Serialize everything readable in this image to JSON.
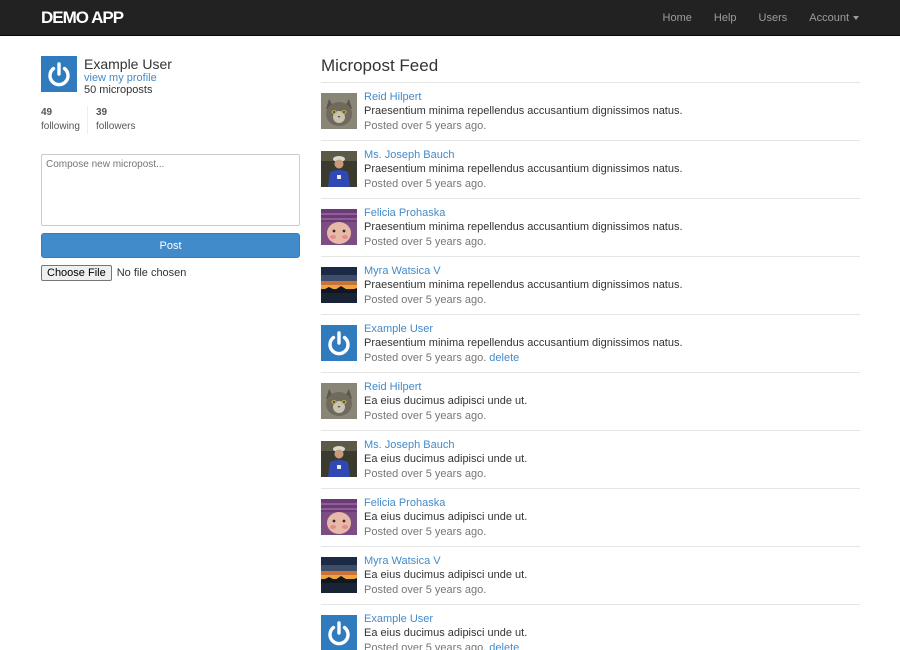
{
  "navbar": {
    "brand": "DEMO APP",
    "links": [
      "Home",
      "Help",
      "Users"
    ],
    "account_label": "Account"
  },
  "sidebar": {
    "user_name": "Example User",
    "profile_link": "view my profile",
    "micropost_count": "50 microposts",
    "stats": [
      {
        "value": "49",
        "label": "following"
      },
      {
        "value": "39",
        "label": "followers"
      }
    ],
    "compose_placeholder": "Compose new micropost...",
    "post_button": "Post",
    "file_button": "Choose File",
    "file_status": "No file chosen"
  },
  "feed": {
    "title": "Micropost Feed",
    "posts": [
      {
        "user": "Reid Hilpert",
        "content": "Praesentium minima repellendus accusantium dignissimos natus.",
        "meta": "Posted over 5 years ago.",
        "avatar": "cat"
      },
      {
        "user": "Ms. Joseph Bauch",
        "content": "Praesentium minima repellendus accusantium dignissimos natus.",
        "meta": "Posted over 5 years ago.",
        "avatar": "person-blue"
      },
      {
        "user": "Felicia Prohaska",
        "content": "Praesentium minima repellendus accusantium dignissimos natus.",
        "meta": "Posted over 5 years ago.",
        "avatar": "baby"
      },
      {
        "user": "Myra Watsica V",
        "content": "Praesentium minima repellendus accusantium dignissimos natus.",
        "meta": "Posted over 5 years ago.",
        "avatar": "sunset"
      },
      {
        "user": "Example User",
        "content": "Praesentium minima repellendus accusantium dignissimos natus.",
        "meta": "Posted over 5 years ago.",
        "avatar": "power",
        "delete": "delete"
      },
      {
        "user": "Reid Hilpert",
        "content": "Ea eius ducimus adipisci unde ut.",
        "meta": "Posted over 5 years ago.",
        "avatar": "cat"
      },
      {
        "user": "Ms. Joseph Bauch",
        "content": "Ea eius ducimus adipisci unde ut.",
        "meta": "Posted over 5 years ago.",
        "avatar": "person-blue"
      },
      {
        "user": "Felicia Prohaska",
        "content": "Ea eius ducimus adipisci unde ut.",
        "meta": "Posted over 5 years ago.",
        "avatar": "baby"
      },
      {
        "user": "Myra Watsica V",
        "content": "Ea eius ducimus adipisci unde ut.",
        "meta": "Posted over 5 years ago.",
        "avatar": "sunset"
      },
      {
        "user": "Example User",
        "content": "Ea eius ducimus adipisci unde ut.",
        "meta": "Posted over 5 years ago.",
        "avatar": "power",
        "delete": "delete"
      }
    ]
  },
  "colors": {
    "navbar_bg": "#222222",
    "link": "#428bca",
    "primary_button": "#428bca",
    "avatar_blue": "#2f7bbd"
  }
}
